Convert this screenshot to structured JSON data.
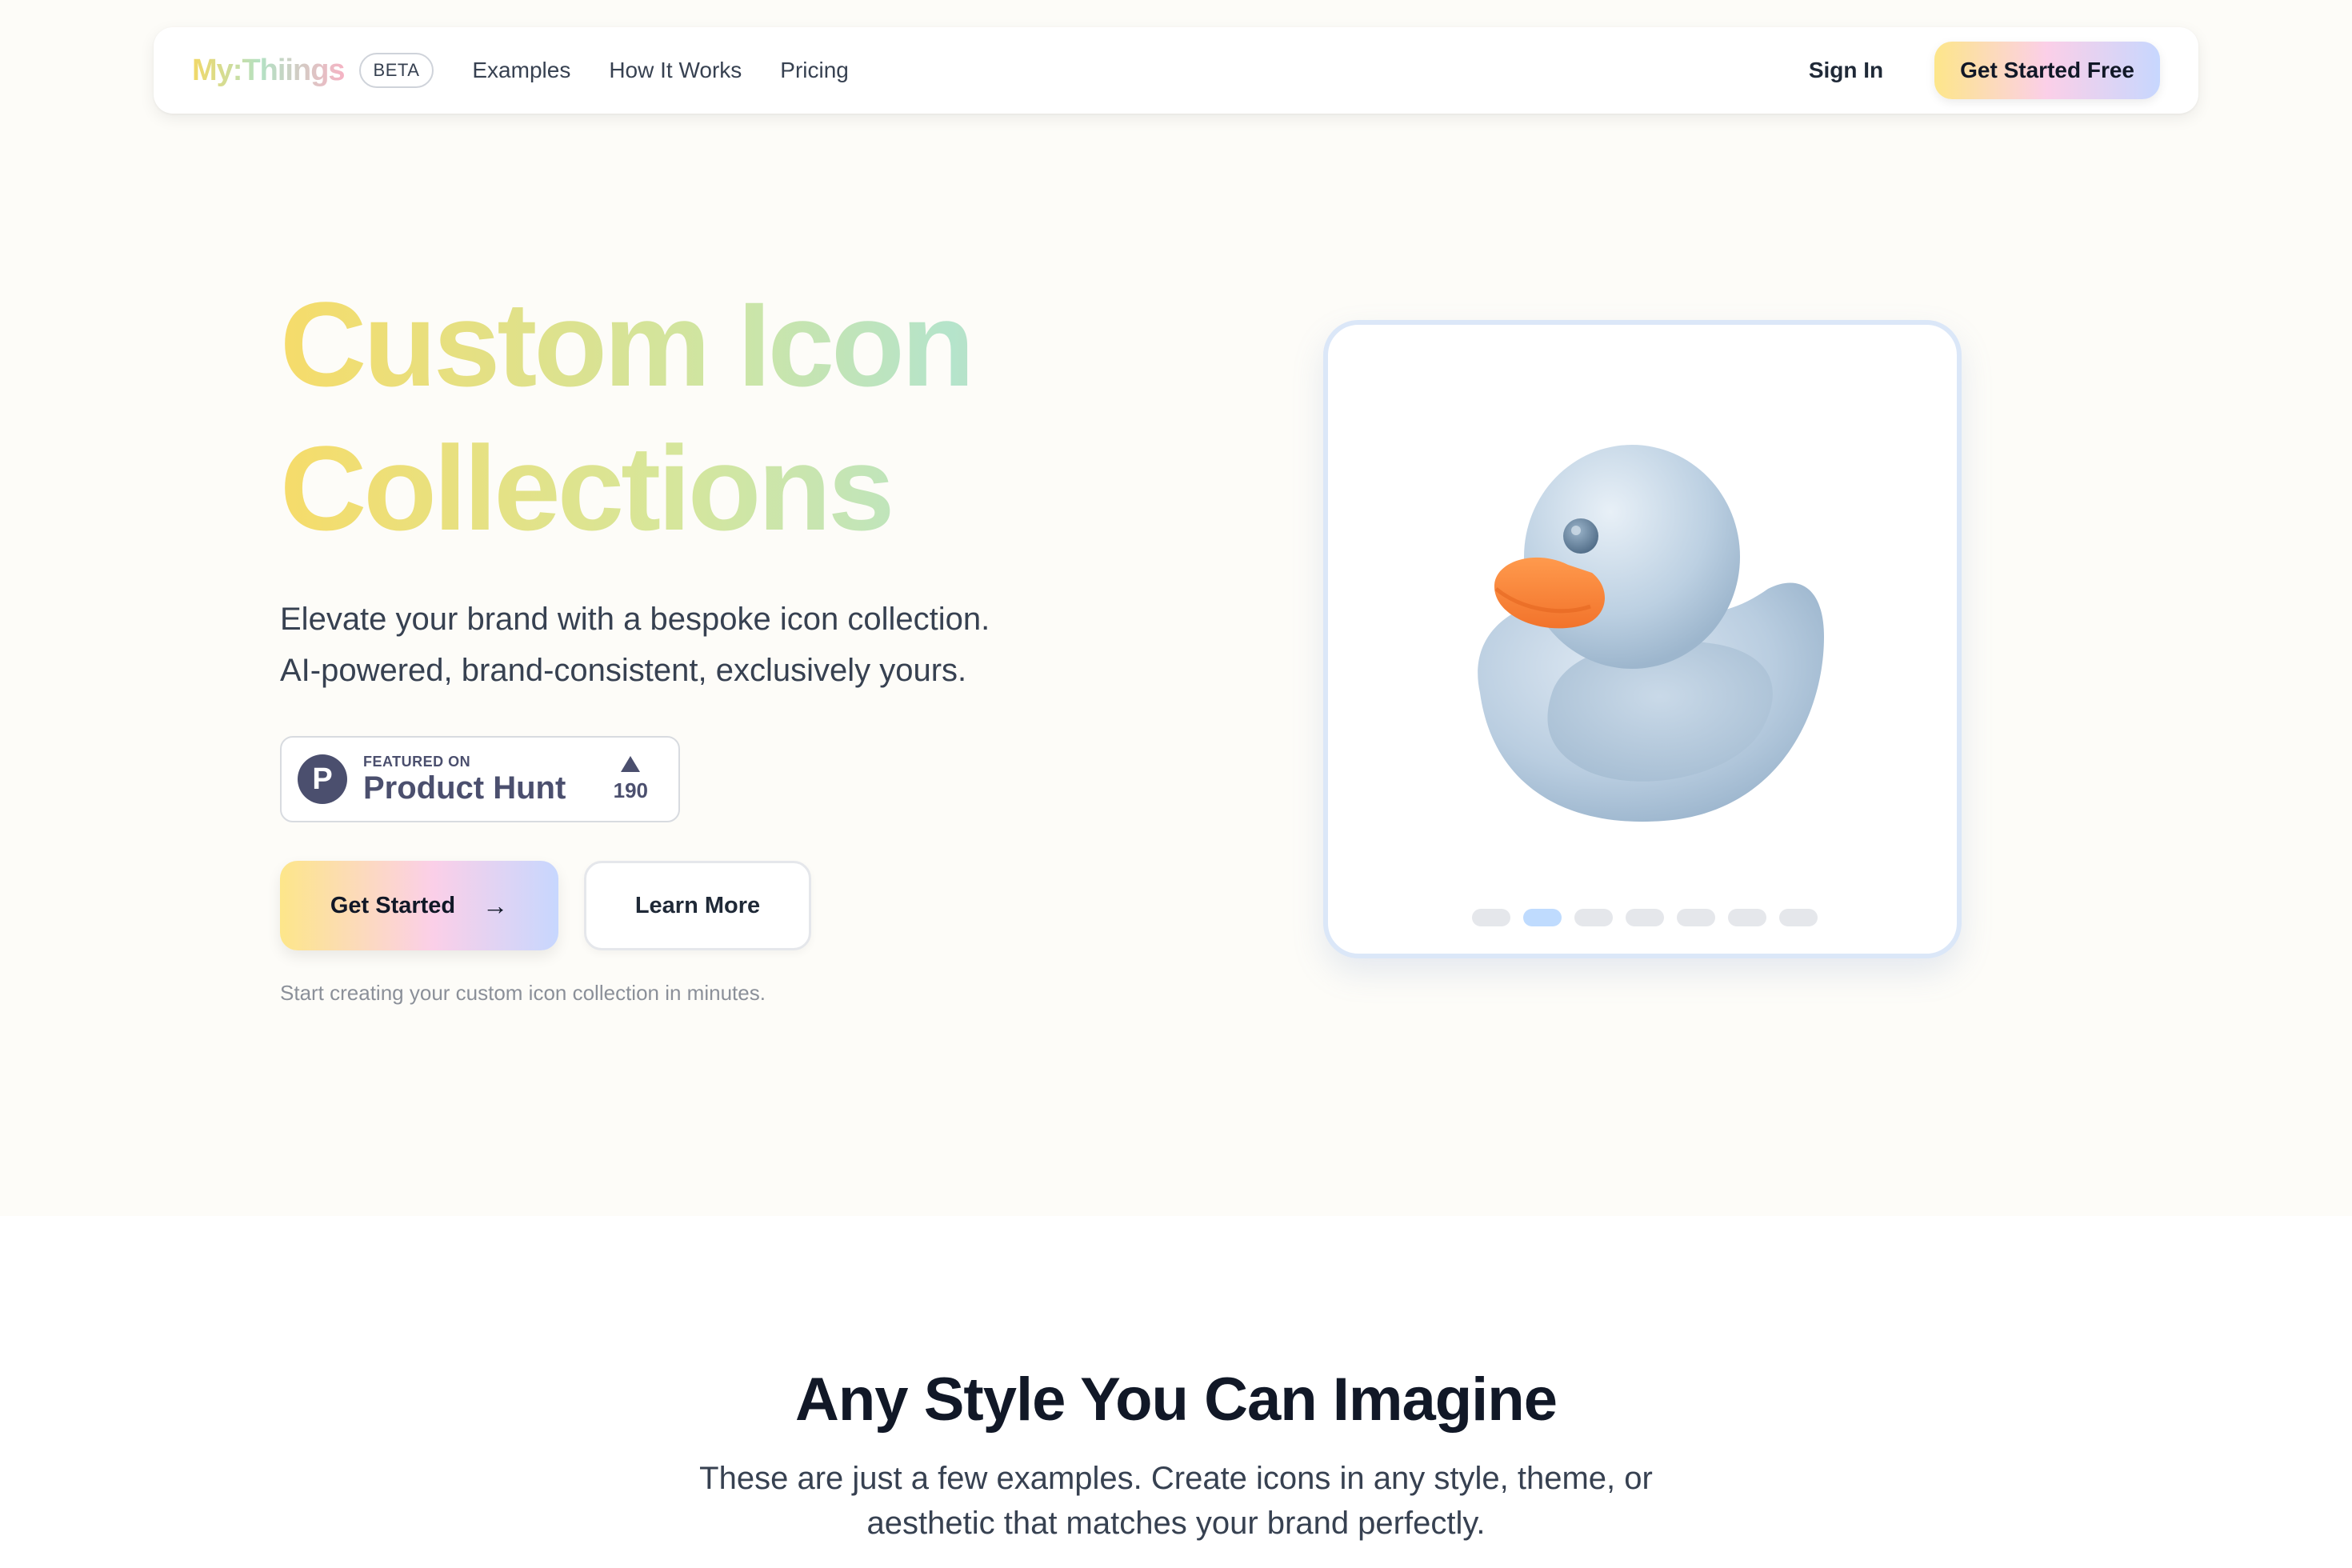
{
  "nav": {
    "logo": "My:Thiings",
    "badge": "BETA",
    "links": [
      "Examples",
      "How It Works",
      "Pricing"
    ],
    "sign_in": "Sign In",
    "cta": "Get Started Free"
  },
  "hero": {
    "title_line1": "Custom Icon",
    "title_line2": "Collections",
    "subtitle_line1": "Elevate your brand with a bespoke icon collection.",
    "subtitle_line2": "AI-powered, brand-consistent, exclusively yours.",
    "product_hunt": {
      "logo_letter": "P",
      "featured": "FEATURED ON",
      "name": "Product Hunt",
      "votes": "190"
    },
    "primary_button": "Get Started",
    "secondary_button": "Learn More",
    "note": "Start creating your custom icon collection in minutes."
  },
  "showcase": {
    "icon": "rubber-duck-icon",
    "slides": 7,
    "active_slide": 2
  },
  "section2": {
    "title": "Any Style You Can Imagine",
    "subtitle_line1": "These are just a few examples. Create icons in any style, theme, or",
    "subtitle_line2": "aesthetic that matches your brand perfectly."
  },
  "colors": {
    "accent_yellow": "#fde68a",
    "accent_pink": "#fbcfe8",
    "accent_blue": "#c7d7fe",
    "product_hunt": "#4b4f6e",
    "duck_body": "#b7cde2",
    "duck_beak": "#f7823a"
  }
}
